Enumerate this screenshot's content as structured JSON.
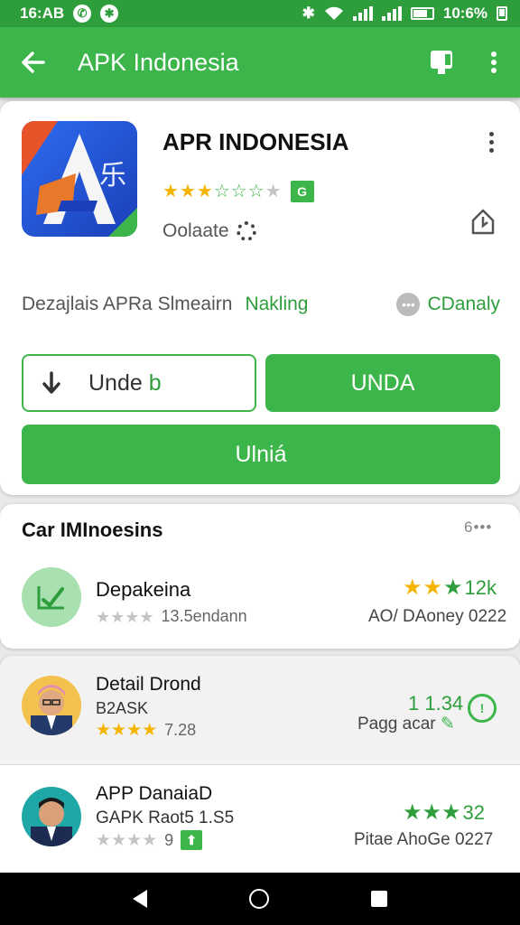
{
  "status_bar": {
    "time": "16:AB",
    "right_text": "10:6% ",
    "icons": [
      "whatsapp-icon",
      "notification-icon",
      "bluetooth-icon",
      "wifi-icon",
      "signal-icon",
      "battery-icon"
    ]
  },
  "app_bar": {
    "title": "APK Indonesia",
    "icons": [
      "back-arrow-icon",
      "cast-icon",
      "more-vert-icon"
    ]
  },
  "app_card": {
    "title": "APR INDONESIA",
    "rating_stars": 3.5,
    "rating_badge": "G",
    "update_label": "Oolaate",
    "tabs": [
      "Dezajlais APRa Slmeairn",
      "Nakling",
      "CDanaly"
    ],
    "buttons": {
      "outline_label": "Unde",
      "outline_suffix": "b",
      "unda_label": "UNDA",
      "ulnia_label": "Ulniá"
    }
  },
  "section": {
    "title": "Car IMInoesins",
    "more": "6•••",
    "rows": [
      {
        "title": "Depakeina",
        "sub_text": "13.5endann",
        "right_top": "12k",
        "right_bottom": "AO/ DAoney 0222",
        "stars": 3
      },
      {
        "title": "Detail Drond",
        "line2": "B2ASK",
        "sub_text": "7.28",
        "right_top": "1 1.34",
        "right_bottom": "Pagg acar",
        "stars": 4
      },
      {
        "title": "APP DanaiaD",
        "line2": "GAPK Raot5 1.S5",
        "sub_text": "9",
        "right_top": "32",
        "right_bottom": "Pitae AhoGe 0227",
        "stars": 3
      }
    ]
  },
  "colors": {
    "primary_green": "#3cb64a",
    "dark_green": "#2e9e3c",
    "star_gold": "#f4b400"
  }
}
